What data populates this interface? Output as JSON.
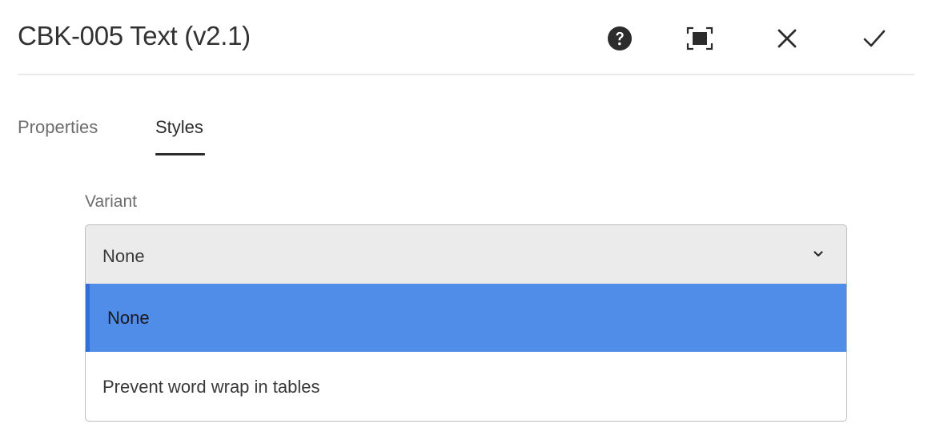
{
  "dialog": {
    "title": "CBK-005 Text (v2.1)",
    "actions": [
      {
        "icon": "help-icon"
      },
      {
        "icon": "fullscreen-icon"
      },
      {
        "icon": "close-icon"
      },
      {
        "icon": "checkmark-icon"
      }
    ]
  },
  "tabs": [
    {
      "label": "Properties",
      "active": false
    },
    {
      "label": "Styles",
      "active": true
    }
  ],
  "variant": {
    "label": "Variant",
    "selected_value": "None",
    "options": [
      {
        "label": "None",
        "highlighted": true
      },
      {
        "label": "Prevent word wrap in tables",
        "highlighted": false
      }
    ]
  },
  "colors": {
    "highlight": "#508de8",
    "highlight_border": "#2f6fd6",
    "select_background": "#ebebeb"
  }
}
